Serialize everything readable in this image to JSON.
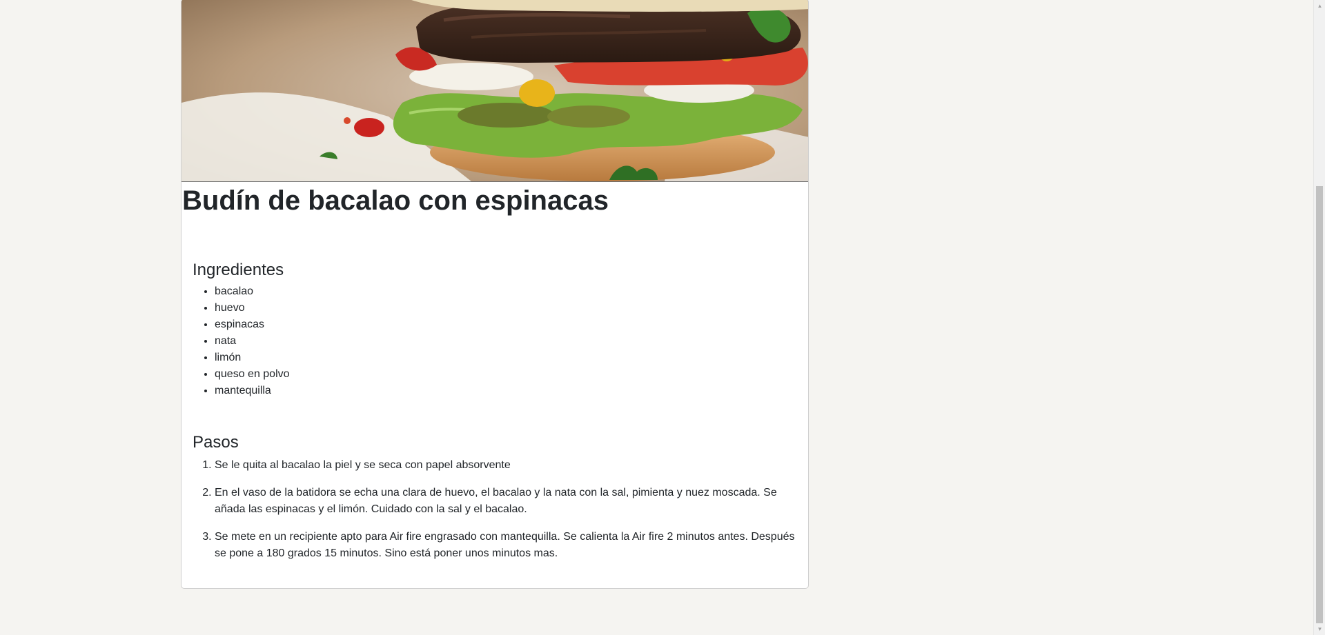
{
  "recipe": {
    "image_alt": "hamburguesa",
    "title": "Budín de bacalao con espinacas",
    "ingredients_title": "Ingredientes",
    "ingredients": [
      "bacalao",
      "huevo",
      "espinacas",
      "nata",
      "limón",
      "queso en polvo",
      "mantequilla"
    ],
    "steps_title": "Pasos",
    "steps": [
      "Se le quita al bacalao la piel y se seca con papel absorvente",
      "En el vaso de la batidora se echa una clara de huevo, el bacalao y la nata con la sal, pimienta y nuez moscada. Se añada las espinacas y el limón. Cuidado con la sal y el bacalao.",
      "Se mete en un recipiente apto para Air fire engrasado con mantequilla. Se calienta la Air fire 2 minutos antes. Después se pone a 180 grados 15 minutos. Sino está poner unos minutos mas."
    ]
  },
  "scrollbar": {
    "up_icon": "triangle-up-icon",
    "down_icon": "triangle-down-icon"
  }
}
